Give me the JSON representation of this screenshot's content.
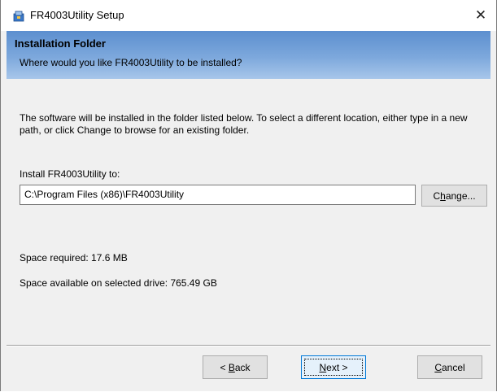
{
  "window": {
    "title": "FR4003Utility Setup",
    "close_glyph": "✕"
  },
  "banner": {
    "title": "Installation Folder",
    "subtitle": "Where would you like FR4003Utility to be installed?"
  },
  "content": {
    "description": "The software will be installed in the folder listed below. To select a different location, either type in a new path, or click Change to browse for an existing folder.",
    "install_label": "Install FR4003Utility to:",
    "install_path": "C:\\Program Files (x86)\\FR4003Utility",
    "change_prefix": "C",
    "change_accel": "h",
    "change_suffix": "ange...",
    "space_required": "Space required: 17.6 MB",
    "space_available": "Space available on selected drive: 765.49 GB"
  },
  "footer": {
    "back_prefix": "< ",
    "back_accel": "B",
    "back_suffix": "ack",
    "next_accel": "N",
    "next_suffix": "ext >",
    "cancel_accel": "C",
    "cancel_suffix": "ancel"
  },
  "colors": {
    "banner_top": "#5c8fcf",
    "banner_bottom": "#a7c6ea",
    "default_button_border": "#0078d7"
  },
  "icons": {
    "app": "installer-package-icon",
    "close": "close-icon"
  }
}
